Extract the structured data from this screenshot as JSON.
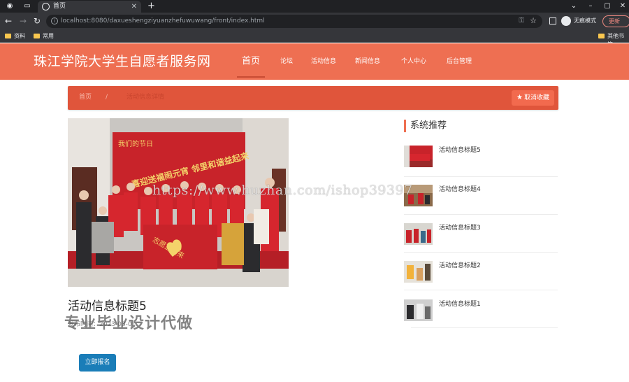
{
  "browser": {
    "tab_title": "首页",
    "url": "localhost:8080/daxueshengziyuanzhefuwuwang/front/index.html",
    "incognito_label": "无痕模式",
    "update_label": "更新",
    "bookmarks": [
      "资料",
      "常用"
    ],
    "other_bookmarks": "其他书签"
  },
  "site": {
    "logo": "珠江学院大学生自愿者服务网",
    "nav": [
      "首页",
      "论坛",
      "活动信息",
      "新闻信息",
      "个人中心",
      "后台管理"
    ],
    "active_nav": "首页",
    "accent_color": "#ee6f52",
    "breadcrumb_bg": "#e0553b"
  },
  "breadcrumb": {
    "home": "首页",
    "separator": "/",
    "current": "活动信息详情"
  },
  "actions": {
    "unfavorite": "取消收藏",
    "signup": "立即报名",
    "signup_color": "#1a7db8"
  },
  "activity": {
    "title": "活动信息标题5",
    "meta": "发布时间：2023-03-01"
  },
  "recommend": {
    "heading": "系统推荐",
    "items": [
      "活动信息标题5",
      "活动信息标题4",
      "活动信息标题3",
      "活动信息标题2",
      "活动信息标题1"
    ]
  },
  "watermarks": {
    "url": "https://www.huzhan.com/ishop39397",
    "chinese": "专业毕业设计代做"
  },
  "banner_text": {
    "main": "喜迎送福闹元宵 邻里和谐益起来",
    "top": "我们的节日",
    "flag": "志愿益起来"
  }
}
